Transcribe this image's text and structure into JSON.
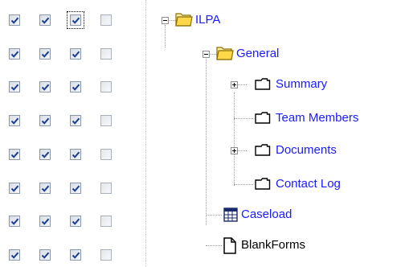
{
  "permissions": {
    "rows": [
      {
        "c1": true,
        "c2": true,
        "c3": true,
        "c4": false
      },
      {
        "c1": true,
        "c2": true,
        "c3": true,
        "c4": false
      },
      {
        "c1": true,
        "c2": true,
        "c3": true,
        "c4": false
      },
      {
        "c1": true,
        "c2": true,
        "c3": true,
        "c4": false
      },
      {
        "c1": true,
        "c2": true,
        "c3": true,
        "c4": false
      },
      {
        "c1": true,
        "c2": true,
        "c3": true,
        "c4": false
      },
      {
        "c1": true,
        "c2": true,
        "c3": true,
        "c4": false
      },
      {
        "c1": true,
        "c2": true,
        "c3": true,
        "c4": false
      }
    ]
  },
  "tree": {
    "root": {
      "label": "ILPA",
      "icon": "open-folder-icon",
      "expander": "minus"
    },
    "general": {
      "label": "General",
      "icon": "open-folder-icon",
      "expander": "minus"
    },
    "summary": {
      "label": "Summary",
      "icon": "form-icon",
      "expander": "plus"
    },
    "team_members": {
      "label": "Team Members",
      "icon": "form-icon"
    },
    "documents": {
      "label": "Documents",
      "icon": "form-icon",
      "expander": "plus"
    },
    "contact_log": {
      "label": "Contact Log",
      "icon": "form-icon"
    },
    "caseload": {
      "label": "Caseload",
      "icon": "grid-report-icon"
    },
    "blankforms": {
      "label": "BlankForms",
      "icon": "document-icon"
    }
  },
  "colors": {
    "link": "#1a1aff",
    "folder_fill": "#ffe97a",
    "folder_border": "#8c6d00",
    "check": "#1b3f91"
  }
}
